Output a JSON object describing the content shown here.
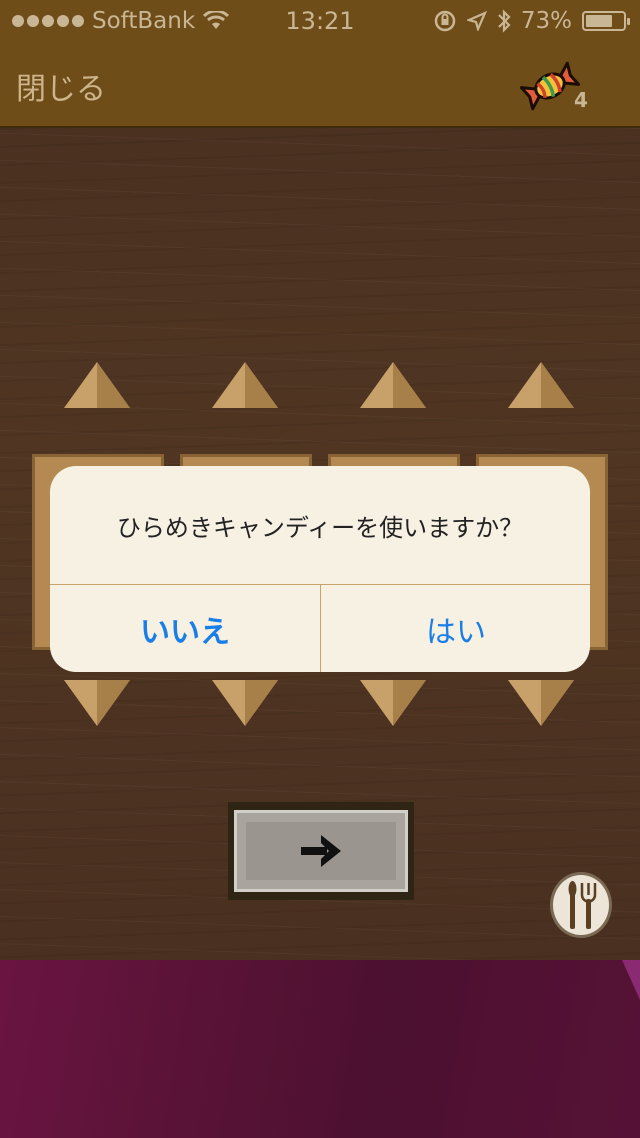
{
  "status_bar": {
    "carrier": "SoftBank",
    "time": "13:21",
    "battery": "73%",
    "battery_level": 0.73,
    "signal_filled": 5,
    "icons": [
      "wifi-icon",
      "orientation-lock-icon",
      "location-icon",
      "bluetooth-icon",
      "battery-icon"
    ]
  },
  "header": {
    "close_label": "閉じる",
    "candy_icon": "candy-icon",
    "candy_count": "4"
  },
  "dialog": {
    "message": "ひらめきキャンディーを使いますか？",
    "no_label": "いいえ",
    "yes_label": "はい"
  },
  "controls": {
    "next_icon": "right-arrow-icon",
    "cutlery_icon": "fork-knife-icon"
  },
  "colors": {
    "header_bg": "#6f4d19",
    "board_bg": "#4a3120",
    "dialog_button": "#1a7ee8",
    "floor": "#5a1336"
  }
}
